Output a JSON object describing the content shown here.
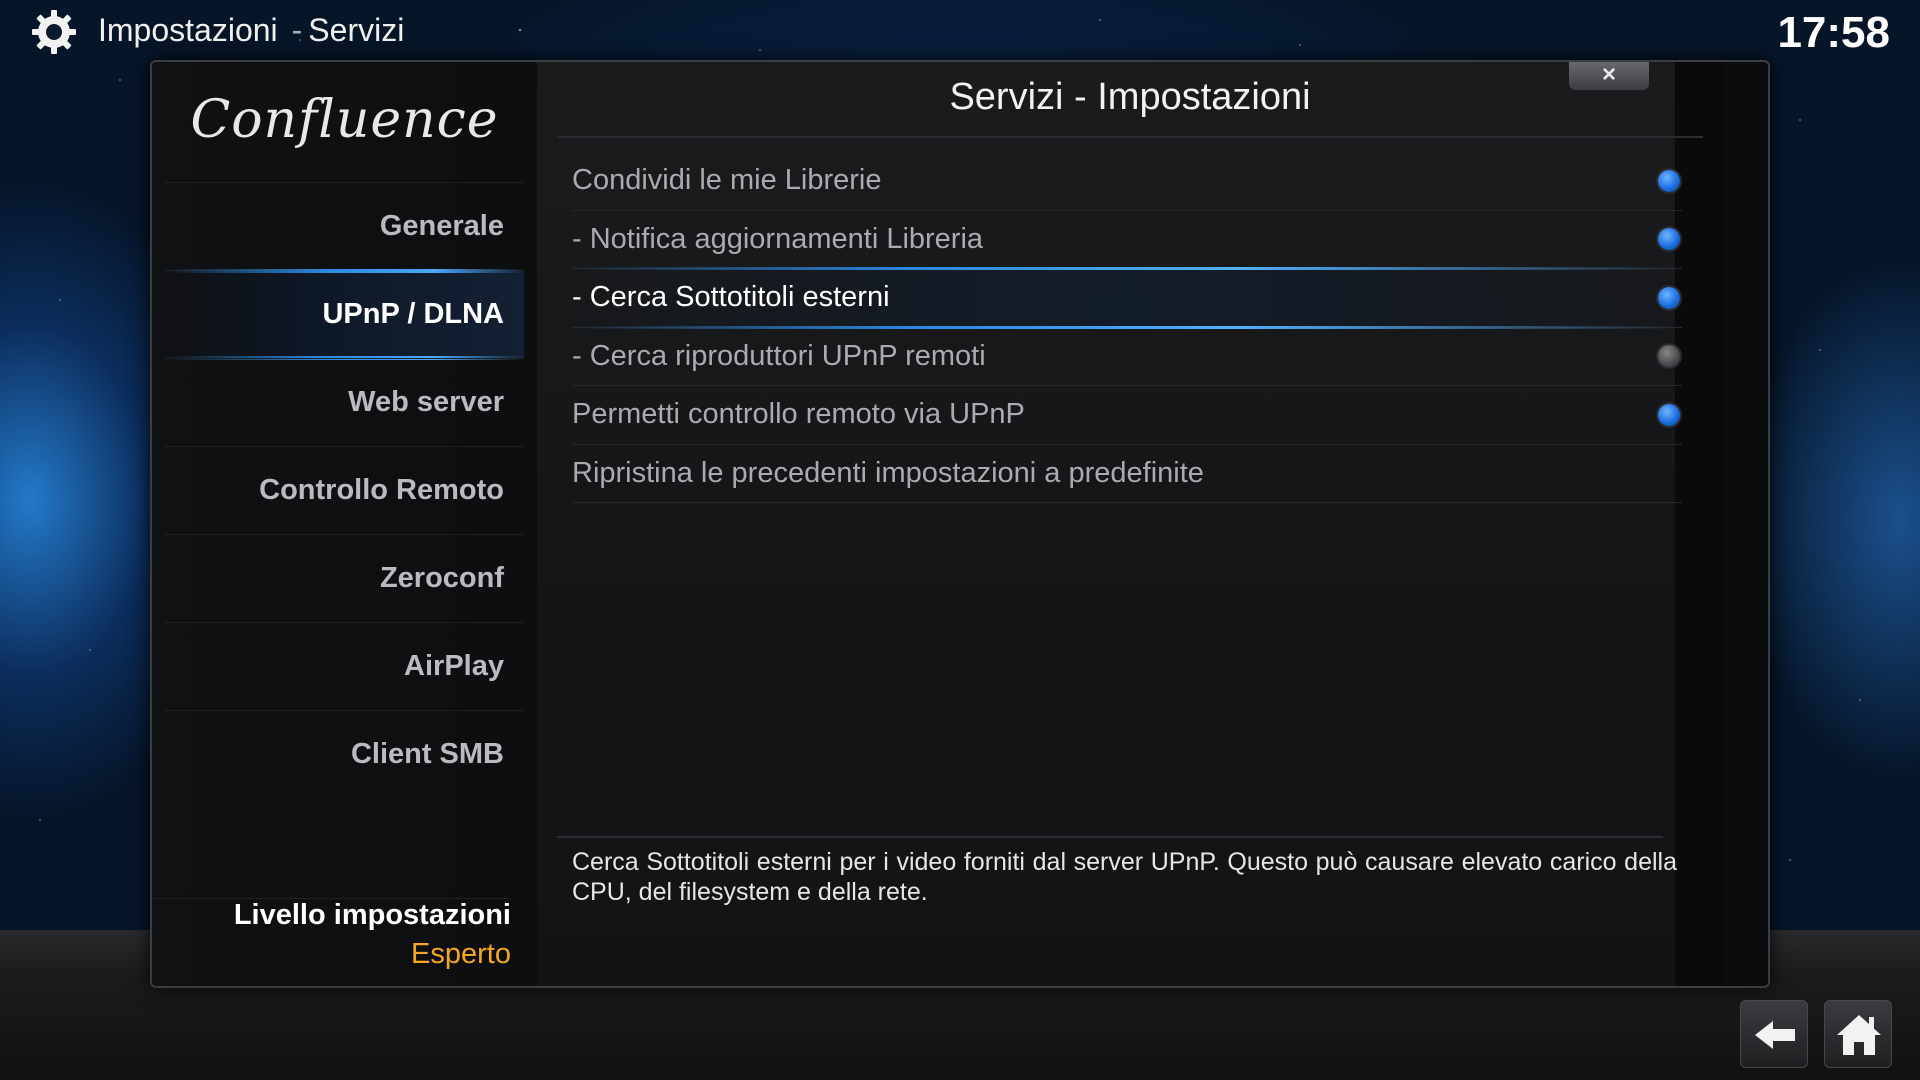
{
  "header": {
    "section": "Impostazioni",
    "separator": "-",
    "page": "Servizi",
    "clock": "17:58"
  },
  "skin": {
    "logo": "Confluence"
  },
  "dialog": {
    "title": "Servizi - Impostazioni",
    "close_label": "×",
    "categories": [
      {
        "label": "Generale",
        "active": false
      },
      {
        "label": "UPnP / DLNA",
        "active": true
      },
      {
        "label": "Web server",
        "active": false
      },
      {
        "label": "Controllo Remoto",
        "active": false
      },
      {
        "label": "Zeroconf",
        "active": false
      },
      {
        "label": "AirPlay",
        "active": false
      },
      {
        "label": "Client SMB",
        "active": false
      }
    ],
    "level": {
      "label": "Livello impostazioni",
      "value": "Esperto"
    },
    "settings": [
      {
        "label": "Condividi le mie Librerie",
        "enabled": true
      },
      {
        "label": "- Notifica aggiornamenti Libreria",
        "enabled": true
      },
      {
        "label": "- Cerca Sottotitoli esterni",
        "enabled": true,
        "focused": true
      },
      {
        "label": "- Cerca riproduttori UPnP remoti",
        "enabled": false
      },
      {
        "label": "Permetti controllo remoto via UPnP",
        "enabled": true
      },
      {
        "label": "Ripristina le precedenti impostazioni a predefinite",
        "action": true
      }
    ],
    "description": "Cerca Sottotitoli esterni per i video forniti dal server UPnP. Questo può causare elevato carico della CPU, del filesystem e della rete."
  },
  "nav": {
    "back_icon": "back-arrow-icon",
    "home_icon": "home-icon"
  },
  "colors": {
    "accent": "#2b86df",
    "level_value": "#f5a623",
    "toggle_on": "#1d6fe0"
  }
}
